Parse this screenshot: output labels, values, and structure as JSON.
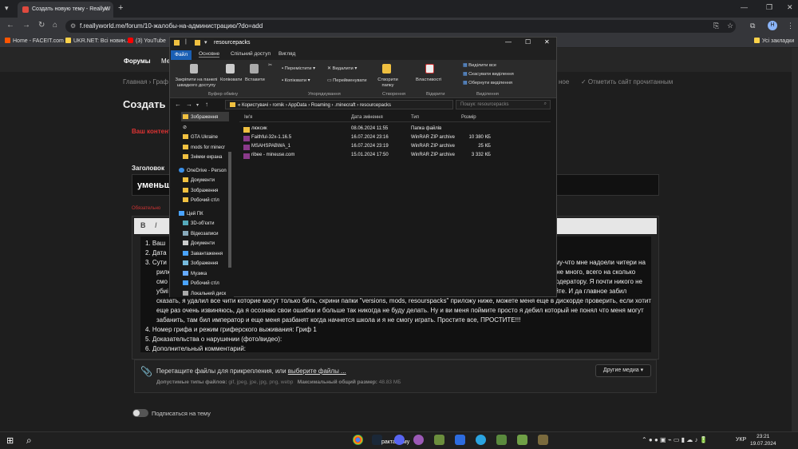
{
  "browser": {
    "tab_title": "Создать новую тему - ReallyW",
    "url": "f.reallyworld.me/forum/10-жалобы-на-администрацию/?do=add",
    "profile_initial": "Н",
    "bookmarks": [
      "Home - FACEIT.com",
      "UKR.NET: Всі новин...",
      "(3) YouTube"
    ],
    "all_bookmarks": "Усі закладки"
  },
  "forum": {
    "nav_items": [
      "Форумы",
      "Ме"
    ],
    "breadcrumb": "Главная  ›  Граф",
    "unwatch": "✓ Отметить сайт прочитанным",
    "page_title": "Создать н",
    "warning": "Ваш контент",
    "title_label": "Заголовок",
    "title_value": "уменьши",
    "required": "Обязательно",
    "editor_items": [
      "Ваш",
      "Дата",
      "Сути"
    ],
    "body_right_lines": [
      "ому-что мне надоели читери на",
      "у не много, всего на сколько",
      "модератору. Я почти никого не",
      "ойте. И да главное забил"
    ],
    "body_left_cont": [
      "рилк",
      "смо",
      "убиі"
    ],
    "body_full_lines": [
      "сказать, я удалил все чити которие могут только бить, скрини папки \"versions, mods, resourspacks\" приложу ниже, можете меня еще в дискорде проверить, если хотите. Я",
      "еще раз очень извиняюсь, да я осознаю свои ошибки и больше так никогда не буду делать. Ну и ви меня поймите просто я дебил который не понял что меня могут",
      "забанить, там бил император и еще меня разбанят когда начнется школа и я не смогу играть. Простите все, ПРОСТИТЕ!!!"
    ],
    "numbered_items": [
      "Номер грифа и режим гриферского выживания: Гриф 1",
      "Доказательства о нарушении (фото/видео):",
      "Дополнительный комментарий:"
    ],
    "drop_text": "Перетащите файлы для прикрепления, или",
    "drop_link": "выберите файлы ...",
    "filetypes_label": "Допустимые типы файлов:",
    "filetypes": "gif, jpeg, jpe, jpg, png, webp",
    "maxsize_label": "Максимальный общий размер:",
    "maxsize": "48.83 МБ",
    "more_media": "Другие медиа ▾",
    "subscribe": "Подписаться на тему"
  },
  "explorer": {
    "title": "resourcepacks",
    "tabs": [
      "Файл",
      "Основне",
      "Спільний доступ",
      "Вигляд"
    ],
    "ribbon": {
      "pin": "Закріпити на панелі швидкого доступу",
      "copy": "Копіювати",
      "paste": "Вставити",
      "move": "Перемістити",
      "copyto": "Копіювати",
      "delete": "Видалити",
      "rename": "Перейменувати",
      "newfolder": "Створити папку",
      "properties": "Властивості",
      "select_all": "Виділити все",
      "deselect": "Скасувати виділення",
      "invert": "Обернути виділення",
      "groups": [
        "Буфер обміну",
        "Упорядкування",
        "Створення",
        "Відкрити",
        "Виділення"
      ]
    },
    "path": [
      "Користувачі",
      "romik",
      "AppData",
      "Roaming",
      ".minecraft",
      "resourcepacks"
    ],
    "search_placeholder": "Пошук: resourcepacks",
    "nav": [
      "Зображення",
      "",
      "GTA Ukraine",
      "mods for minecr",
      "Знімки екрана",
      "OneDrive - Person",
      "Документи",
      "Зображення",
      "Робочий стіл",
      "Цей ПК",
      "3D-об'єкти",
      "Відеозаписи",
      "Документи",
      "Завантаження",
      "Зображення",
      "Музика",
      "Робочий стіл",
      "Локальний диск"
    ],
    "columns": [
      "Ім'я",
      "Дата змінення",
      "Тип",
      "Розмір"
    ],
    "files": [
      {
        "name": "люксик",
        "date": "08.06.2024 11:55",
        "type": "Папка файлів",
        "size": ""
      },
      {
        "name": "Faithful-32x-1.16.5",
        "date": "16.07.2024 23:16",
        "type": "WinRAR ZIP archive",
        "size": "10 380 КБ"
      },
      {
        "name": "MSAHSPABWA_1",
        "date": "16.07.2024 23:19",
        "type": "WinRAR ZIP archive",
        "size": "25 КБ"
      },
      {
        "name": "ribee - mineuse.com",
        "date": "15.01.2024 17:50",
        "type": "WinRAR ZIP archive",
        "size": "3 332 КБ"
      }
    ]
  },
  "taskbar": {
    "lang": "УКР",
    "time": "23:21",
    "date": "19.07.2024",
    "label": "ракта тему"
  }
}
